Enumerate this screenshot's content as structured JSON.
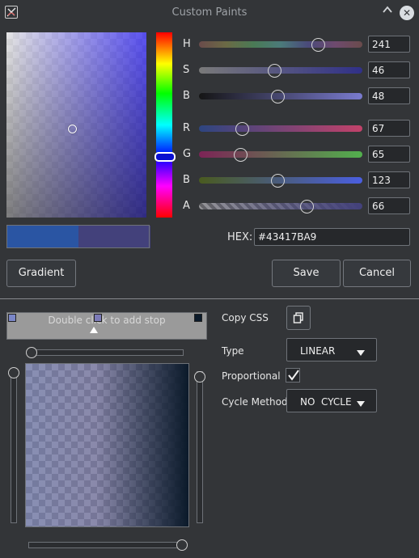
{
  "window": {
    "title": "Custom Paints"
  },
  "colors": {
    "current_hex": "#43417BA9",
    "previous_swatch": "#2a55a3",
    "new_swatch": "#43417b",
    "accent": "#4a5ee0"
  },
  "sliders": [
    {
      "label": "H",
      "value": "241",
      "fraction": 0.73
    },
    {
      "label": "S",
      "value": "46",
      "fraction": 0.46
    },
    {
      "label": "B",
      "value": "48",
      "fraction": 0.48
    },
    {
      "label": "R",
      "value": "67",
      "fraction": 0.26
    },
    {
      "label": "G",
      "value": "65",
      "fraction": 0.25
    },
    {
      "label": "B",
      "value": "123",
      "fraction": 0.48
    },
    {
      "label": "A",
      "value": "66",
      "fraction": 0.66
    }
  ],
  "hex": {
    "label": "HEX:",
    "value": "#43417BA9"
  },
  "buttons": {
    "gradient": "Gradient",
    "save": "Save",
    "cancel": "Cancel"
  },
  "gradient": {
    "hint": "Double click to add stop",
    "copy_css_label": "Copy CSS",
    "type_label": "Type",
    "type_value": "LINEAR",
    "proportional_label": "Proportional",
    "proportional_checked": true,
    "cycle_label": "Cycle Method",
    "cycle_value": "NO  CYCLE",
    "stops": [
      {
        "color": "#7a86c8",
        "position": 0.0
      },
      {
        "color": "#7c7bb8",
        "position": 0.44
      },
      {
        "color": "#0b1a2a",
        "position": 1.0
      }
    ]
  },
  "icons": {
    "app": "app-logo-icon",
    "minimize": "chevron-up-icon",
    "close": "close-icon",
    "copy": "copy-icon",
    "dropdown": "caret-down-icon",
    "check": "checkmark-icon"
  }
}
